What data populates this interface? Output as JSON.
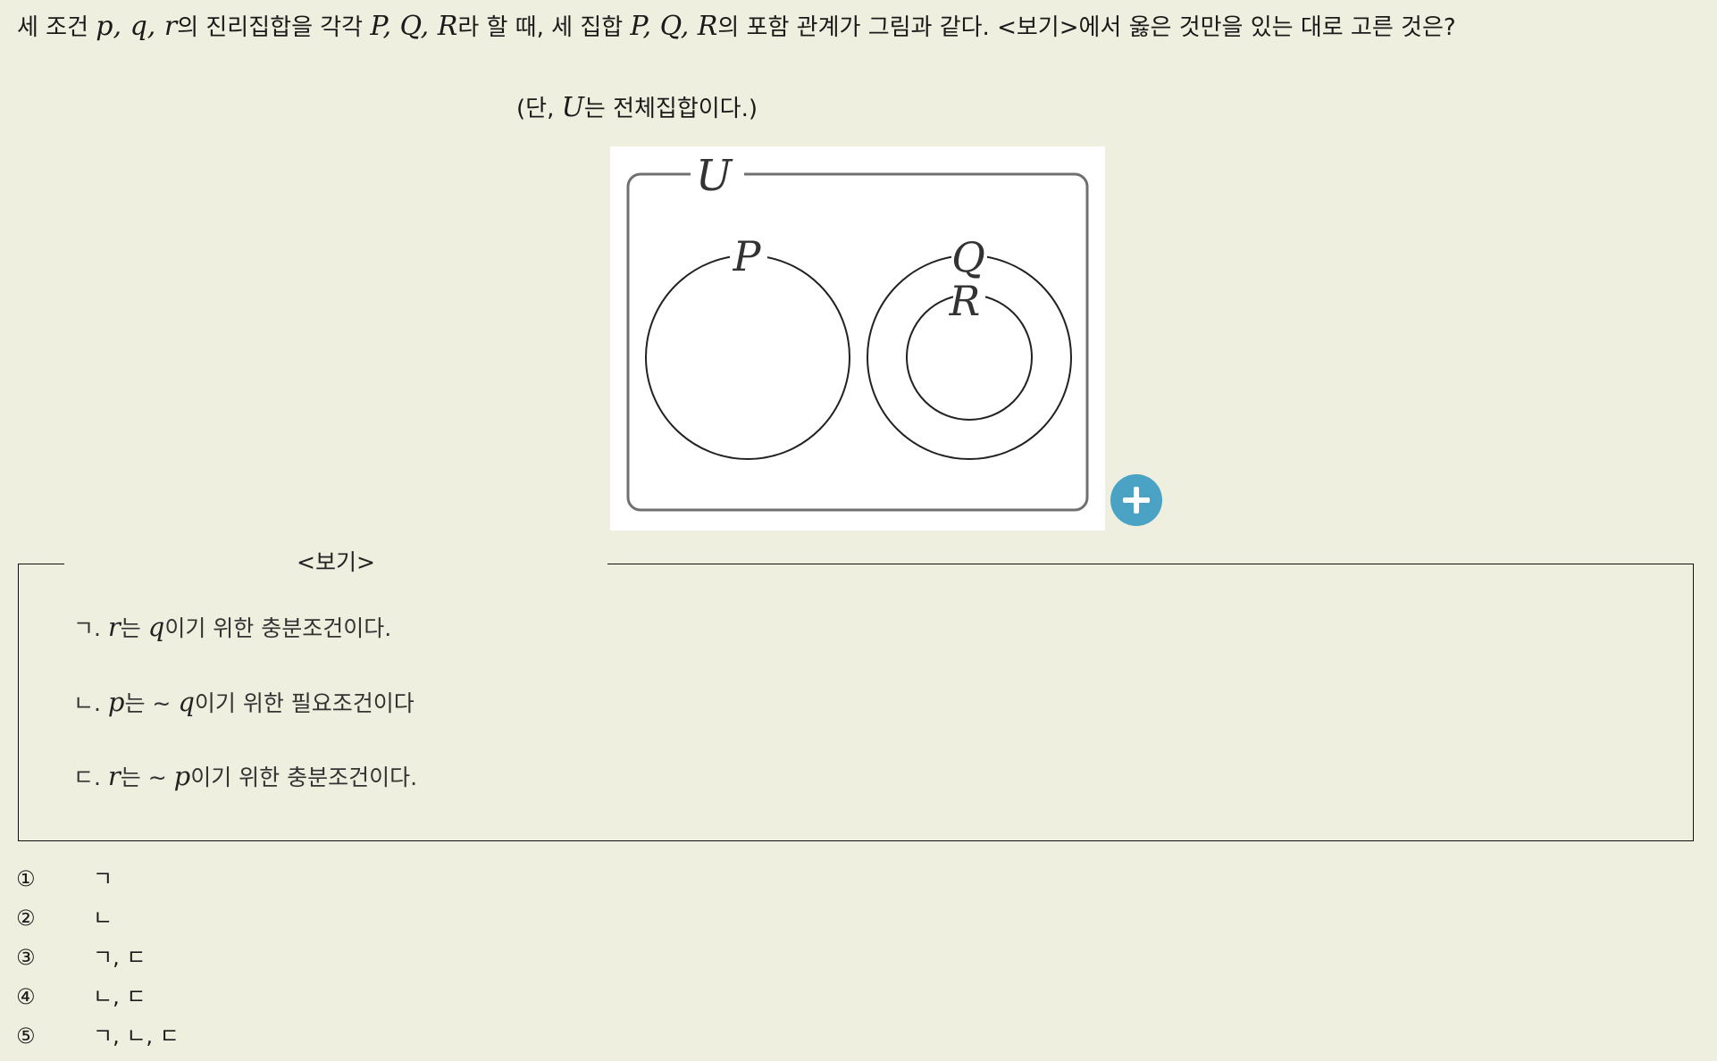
{
  "question": {
    "t1": "세 조건 ",
    "vars_lower": "p, q, r",
    "t2": "의 진리집합을 각각 ",
    "sets1": "P, Q, R",
    "t3": "라 할 때, 세 집합 ",
    "sets2": "P, Q, R",
    "t4": "의 포함 관계가 그림과 같다. <보기>에서 옳은 것만을 있는 대로 고른 것은?"
  },
  "note": {
    "open": "(단, ",
    "universe": "U",
    "rest": "는 전체집합이다.)"
  },
  "figure": {
    "label_u": "U",
    "label_p": "P",
    "label_q": "Q",
    "label_r": "R"
  },
  "zoom_icon": "plus-icon",
  "accent_color": "#4aa3c4",
  "bogi": {
    "title": "<보기>",
    "items": [
      {
        "marker": "ㄱ. ",
        "v1": "r",
        "t1": "는 ",
        "v2": "q",
        "t2": "이기 위한 충분조건이다."
      },
      {
        "marker": "ㄴ. ",
        "v1": "p",
        "t1": "는 ∼ ",
        "v2": "q",
        "t2": "이기 위한 필요조건이다"
      },
      {
        "marker": "ㄷ. ",
        "v1": "r",
        "t1": "는 ∼ ",
        "v2": "p",
        "t2": "이기 위한 충분조건이다."
      }
    ]
  },
  "choices": [
    {
      "num": "①",
      "answer": "ㄱ"
    },
    {
      "num": "②",
      "answer": "ㄴ"
    },
    {
      "num": "③",
      "answer": "ㄱ, ㄷ"
    },
    {
      "num": "④",
      "answer": "ㄴ, ㄷ"
    },
    {
      "num": "⑤",
      "answer": "ㄱ, ㄴ, ㄷ"
    }
  ]
}
